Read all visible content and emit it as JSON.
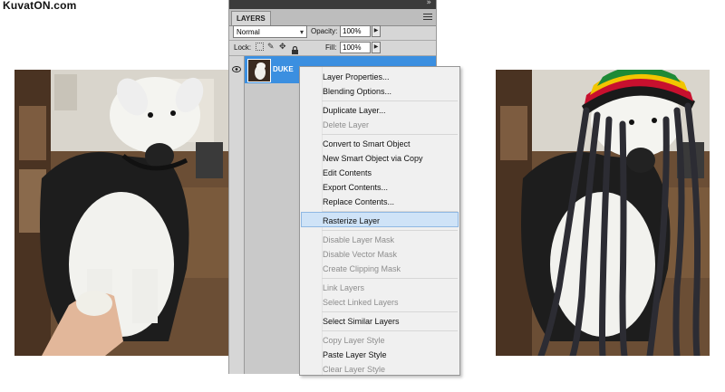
{
  "watermark": "KuvatON.com",
  "panel": {
    "tab_label": "LAYERS",
    "blend_mode": "Normal",
    "opacity_label": "Opacity:",
    "opacity_value": "100%",
    "lock_label": "Lock:",
    "fill_label": "Fill:",
    "fill_value": "100%",
    "layer_name": "DUKE"
  },
  "menu": {
    "items": [
      {
        "label": "Layer Properties...",
        "enabled": true
      },
      {
        "label": "Blending Options...",
        "enabled": true
      },
      {
        "label": "Duplicate Layer...",
        "enabled": true
      },
      {
        "label": "Delete Layer",
        "enabled": false
      },
      {
        "label": "Convert to Smart Object",
        "enabled": true
      },
      {
        "label": "New Smart Object via Copy",
        "enabled": true
      },
      {
        "label": "Edit Contents",
        "enabled": true
      },
      {
        "label": "Export Contents...",
        "enabled": true
      },
      {
        "label": "Replace Contents...",
        "enabled": true
      },
      {
        "label": "Rasterize Layer",
        "enabled": true,
        "highlighted": true
      },
      {
        "label": "Disable Layer Mask",
        "enabled": false
      },
      {
        "label": "Disable Vector Mask",
        "enabled": false
      },
      {
        "label": "Create Clipping Mask",
        "enabled": false
      },
      {
        "label": "Link Layers",
        "enabled": false
      },
      {
        "label": "Select Linked Layers",
        "enabled": false
      },
      {
        "label": "Select Similar Layers",
        "enabled": true
      },
      {
        "label": "Copy Layer Style",
        "enabled": false
      },
      {
        "label": "Paste Layer Style",
        "enabled": true
      },
      {
        "label": "Clear Layer Style",
        "enabled": false
      }
    ]
  },
  "colors": {
    "selection_blue": "#3b8fe0",
    "menu_highlight": "#cfe3f7",
    "panel_gray": "#d6d6d6"
  }
}
